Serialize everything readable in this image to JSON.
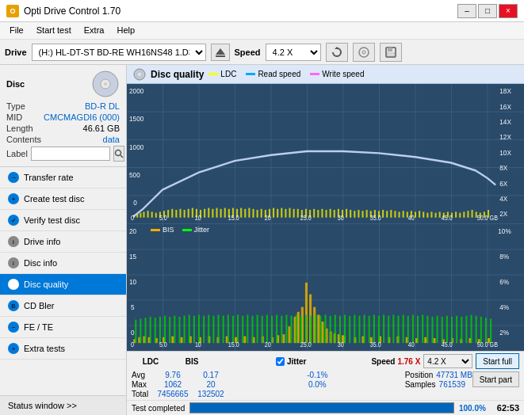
{
  "titleBar": {
    "title": "Opti Drive Control 1.70",
    "minimizeLabel": "–",
    "maximizeLabel": "□",
    "closeLabel": "×"
  },
  "menuBar": {
    "items": [
      "File",
      "Start test",
      "Extra",
      "Help"
    ]
  },
  "driveToolbar": {
    "driveLabel": "Drive",
    "driveValue": "(H:)  HL-DT-ST BD-RE  WH16NS48 1.D3",
    "speedLabel": "Speed",
    "speedValue": "4.2 X"
  },
  "disc": {
    "typeLabel": "Type",
    "typeValue": "BD-R DL",
    "midLabel": "MID",
    "midValue": "CMCMAGDI6 (000)",
    "lengthLabel": "Length",
    "lengthValue": "46.61 GB",
    "contentsLabel": "Contents",
    "contentsValue": "data",
    "labelLabel": "Label",
    "labelValue": ""
  },
  "navItems": [
    {
      "id": "transfer-rate",
      "label": "Transfer rate",
      "active": false
    },
    {
      "id": "create-test-disc",
      "label": "Create test disc",
      "active": false
    },
    {
      "id": "verify-test-disc",
      "label": "Verify test disc",
      "active": false
    },
    {
      "id": "drive-info",
      "label": "Drive info",
      "active": false
    },
    {
      "id": "disc-info",
      "label": "Disc info",
      "active": false
    },
    {
      "id": "disc-quality",
      "label": "Disc quality",
      "active": true
    },
    {
      "id": "cd-bler",
      "label": "CD Bler",
      "active": false
    },
    {
      "id": "fe-te",
      "label": "FE / TE",
      "active": false
    },
    {
      "id": "extra-tests",
      "label": "Extra tests",
      "active": false
    }
  ],
  "statusWindow": {
    "label": "Status window >>"
  },
  "discQuality": {
    "title": "Disc quality",
    "legendItems": [
      {
        "label": "LDC",
        "color": "#ffff00"
      },
      {
        "label": "Read speed",
        "color": "#00aaff"
      },
      {
        "label": "Write speed",
        "color": "#ff66ff"
      }
    ],
    "legendItems2": [
      {
        "label": "BIS",
        "color": "#ffaa00"
      },
      {
        "label": "Jitter",
        "color": "#00ff00"
      }
    ],
    "upperChart": {
      "yMax": 2000,
      "yLabelsLeft": [
        "2000",
        "1500",
        "1000",
        "500",
        "0"
      ],
      "yLabelsRight": [
        "18X",
        "16X",
        "14X",
        "12X",
        "10X",
        "8X",
        "6X",
        "4X",
        "2X"
      ],
      "xLabels": [
        "0",
        "5.0",
        "10",
        "15.0",
        "20",
        "25.0",
        "30",
        "35.0",
        "40",
        "45.0",
        "50.0 GB"
      ]
    },
    "lowerChart": {
      "yMax": 20,
      "yLabelsLeft": [
        "20",
        "15",
        "10",
        "5",
        "0"
      ],
      "yLabelsRight": [
        "10%",
        "8%",
        "6%",
        "4%",
        "2%"
      ],
      "xLabels": [
        "0",
        "5.0",
        "10",
        "15.0",
        "20",
        "25.0",
        "30",
        "35.0",
        "40",
        "45.0",
        "50.0 GB"
      ]
    }
  },
  "stats": {
    "columns": [
      {
        "header": "LDC",
        "avg": "9.76",
        "max": "1062",
        "total": "7456665"
      },
      {
        "header": "BIS",
        "avg": "0.17",
        "max": "20",
        "total": "132502"
      }
    ],
    "jitter": {
      "label": "Jitter",
      "checked": true,
      "avg": "-0.1%",
      "max": "0.0%",
      "total": ""
    },
    "speed": {
      "label": "Speed",
      "value": "1.76 X",
      "speedSelectValue": "4.2 X"
    },
    "position": {
      "label": "Position",
      "value": "47731 MB"
    },
    "samples": {
      "label": "Samples",
      "value": "761539"
    },
    "rowLabels": [
      "Avg",
      "Max",
      "Total"
    ]
  },
  "bottomBar": {
    "statusText": "Test completed",
    "progressValue": "100.0%",
    "timeValue": "62:53",
    "startFullLabel": "Start full",
    "startPartLabel": "Start part"
  }
}
